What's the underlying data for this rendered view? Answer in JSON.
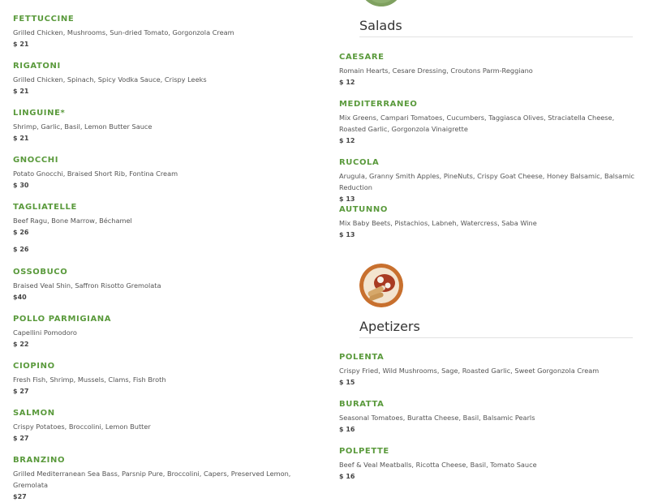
{
  "left_items": [
    {
      "name": "FETTUCCINE",
      "desc": "Grilled Chicken, Mushrooms, Sun-dried Tomato, Gorgonzola Cream",
      "price": "$ 21"
    },
    {
      "name": "RIGATONI",
      "desc": "Grilled Chicken, Spinach, Spicy Vodka Sauce, Crispy Leeks",
      "price": "$ 21"
    },
    {
      "name": "LINGUINE*",
      "desc": "Shrimp, Garlic, Basil, Lemon Butter Sauce",
      "price": "$ 21"
    },
    {
      "name": "GNOCCHI",
      "desc": "Potato Gnocchi, Braised Short Rib, Fontina Cream",
      "price": "$ 30"
    },
    {
      "name": "TAGLIATELLE",
      "desc": "Beef Ragu, Bone Marrow, Béchamel",
      "price": "$ 26"
    },
    {
      "name": "OSSOBUCO",
      "desc": "Braised Veal Shin, Saffron Risotto  Gremolata",
      "price": "$40"
    },
    {
      "name": "POLLO PARMIGIANA",
      "desc": "Capellini Pomodoro",
      "price": "$ 22"
    },
    {
      "name": "CIOPINO",
      "desc": "Fresh Fish, Shrimp, Mussels, Clams, Fish Broth",
      "price": "$ 27"
    },
    {
      "name": "SALMON",
      "desc": "Crispy Potatoes, Broccolini, Lemon Butter",
      "price": "$ 27"
    },
    {
      "name": "BRANZINO",
      "desc": "Grilled Mediterranean Sea Bass, Parsnip Pure, Broccolini, Capers, Preserved Lemon, Gremolata",
      "price": "$27"
    }
  ],
  "stray_price": "$ 26",
  "salads": {
    "title": "Salads",
    "items": [
      {
        "name": "CAESARE",
        "desc": "Romain Hearts, Cesare Dressing, Croutons Parm-Reggiano",
        "price": "$ 12"
      },
      {
        "name": "MEDITERRANEO",
        "desc": "Mix Greens, Campari Tomatoes, Cucumbers, Taggiasca Olives, Straciatella Cheese, Roasted Garlic, Gorgonzola Vinaigrette",
        "price": "$ 12"
      },
      {
        "name": "RUCOLA",
        "desc": "Arugula, Granny Smith Apples, PineNuts, Crispy Goat Cheese, Honey Balsamic, Balsamic Reduction",
        "price": "$ 13"
      },
      {
        "name": "AUTUNNO",
        "desc": "Mix Baby Beets, Pistachios, Labneh, Watercress, Saba Wine",
        "price": "$ 13"
      }
    ]
  },
  "appetizers": {
    "title": "Apetizers",
    "items": [
      {
        "name": "POLENTA",
        "desc": "Crispy Fried, Wild Mushrooms, Sage, Roasted Garlic, Sweet Gorgonzola Cream",
        "price": "$ 15"
      },
      {
        "name": "BURATTA",
        "desc": "Seasonal Tomatoes, Buratta Cheese, Basil, Balsamic Pearls",
        "price": "$ 16"
      },
      {
        "name": "POLPETTE",
        "desc": "Beef & Veal Meatballs, Ricotta Cheese, Basil, Tomato Sauce",
        "price": "$ 16"
      }
    ]
  },
  "colors": {
    "accent": "#5a9a3c",
    "text": "#555555"
  }
}
